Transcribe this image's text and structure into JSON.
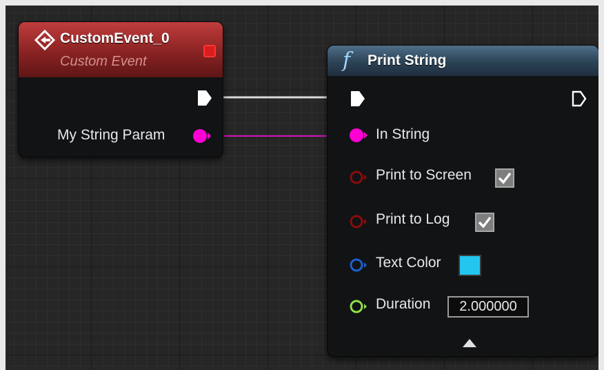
{
  "event_node": {
    "title": "CustomEvent_0",
    "subtitle": "Custom Event",
    "param_label": "My String Param",
    "header_color": "#a02e2e",
    "delegate_pin_color": "#ff2a2a"
  },
  "function_node": {
    "glyph": "f",
    "title": "Print String",
    "header_color": "#2c4256",
    "pins": {
      "in_string": "In String",
      "print_to_screen": "Print to Screen",
      "print_to_log": "Print to Log",
      "text_color": "Text Color",
      "duration": "Duration"
    },
    "values": {
      "print_to_screen_checked": true,
      "print_to_log_checked": true,
      "text_color_value": "#23c6ee",
      "duration_value": "2.000000"
    }
  },
  "pin_colors": {
    "exec": "#ffffff",
    "string": "#ff00d4",
    "bool": "#8a0c0c",
    "struct": "#1d5fd1",
    "float": "#8fe04a"
  },
  "icons": [
    "event-diamond-icon",
    "function-f-icon",
    "exec-pin-icon",
    "checkmark-icon",
    "expand-arrow-icon"
  ]
}
